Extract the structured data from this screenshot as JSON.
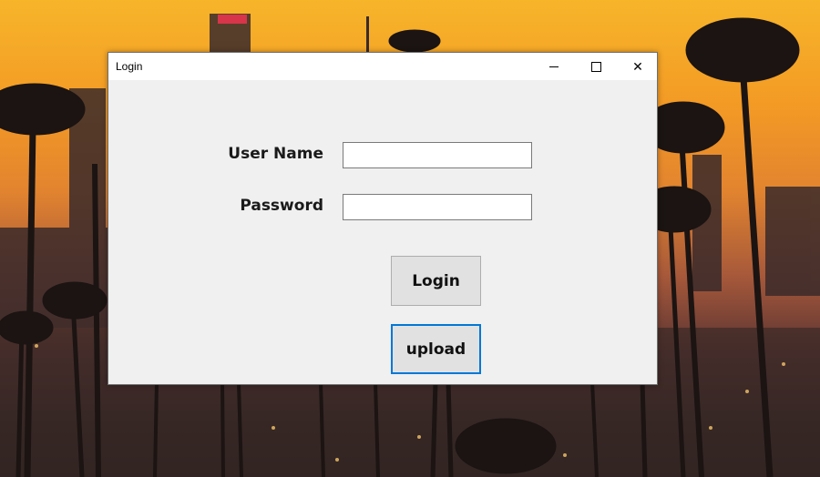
{
  "window": {
    "title": "Login",
    "controls": {
      "minimize": "minimize-icon",
      "maximize": "maximize-icon",
      "close": "close-icon",
      "close_glyph": "✕"
    }
  },
  "form": {
    "username_label": "User Name",
    "username_value": "",
    "password_label": "Password",
    "password_value": "",
    "login_button": "Login",
    "upload_button": "upload"
  },
  "colors": {
    "focus_border": "#0078d7",
    "window_bg": "#f0f0f0",
    "button_bg": "#e1e1e1"
  }
}
